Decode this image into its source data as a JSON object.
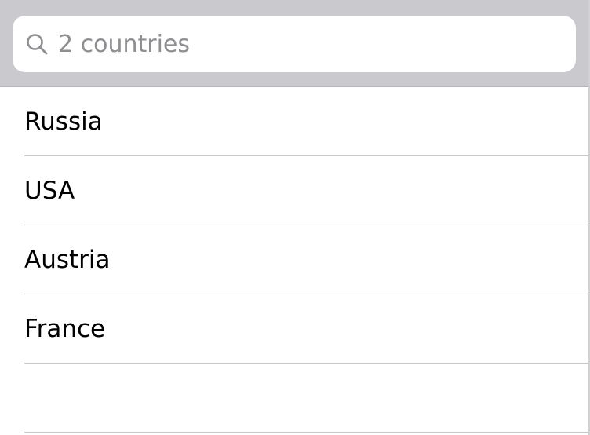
{
  "search": {
    "placeholder": "2 countries",
    "icon": "search-icon"
  },
  "countries": [
    {
      "label": "Russia"
    },
    {
      "label": "USA"
    },
    {
      "label": "Austria"
    },
    {
      "label": "France"
    },
    {
      "label": ""
    }
  ],
  "colors": {
    "search_bar_bg": "#c9c9ce",
    "search_field_bg": "#ffffff",
    "placeholder": "#8e8e93",
    "separator": "#c8c7cc",
    "text": "#000000"
  }
}
